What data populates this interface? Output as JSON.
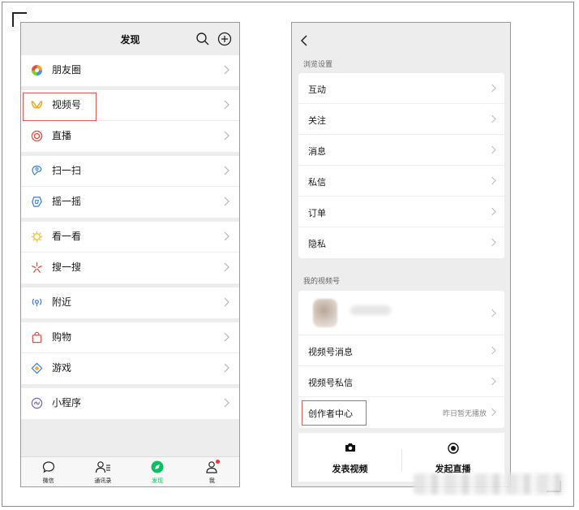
{
  "left_phone": {
    "header": {
      "title": "发现"
    },
    "sections": [
      [
        {
          "label": "朋友圈",
          "icon": "moments-icon"
        }
      ],
      [
        {
          "label": "视频号",
          "icon": "channels-icon"
        },
        {
          "label": "直播",
          "icon": "live-icon"
        }
      ],
      [
        {
          "label": "扫一扫",
          "icon": "scan-icon"
        },
        {
          "label": "摇一摇",
          "icon": "shake-icon"
        }
      ],
      [
        {
          "label": "看一看",
          "icon": "top-stories-icon"
        },
        {
          "label": "搜一搜",
          "icon": "search-star-icon"
        }
      ],
      [
        {
          "label": "附近",
          "icon": "nearby-icon"
        }
      ],
      [
        {
          "label": "购物",
          "icon": "shopping-icon"
        },
        {
          "label": "游戏",
          "icon": "games-icon"
        }
      ],
      [
        {
          "label": "小程序",
          "icon": "mini-programs-icon"
        }
      ]
    ],
    "tabbar": [
      {
        "label": "微信",
        "icon": "chat-icon"
      },
      {
        "label": "通讯录",
        "icon": "contacts-icon"
      },
      {
        "label": "发现",
        "icon": "discover-icon",
        "active": true
      },
      {
        "label": "我",
        "icon": "me-icon",
        "badge": true
      }
    ]
  },
  "right_phone": {
    "browse_settings": {
      "title": "浏览设置",
      "items": [
        "互动",
        "关注",
        "消息",
        "私信",
        "订单",
        "隐私"
      ]
    },
    "my_channel": {
      "title": "我的视频号",
      "items": [
        "视频号消息",
        "视频号私信",
        "创作者中心"
      ],
      "creator_status": "昨日暂无播放"
    },
    "actions": {
      "post_video": "发表视频",
      "start_live": "发起直播"
    }
  },
  "colors": {
    "accent_green": "#07c160",
    "highlight_red": "#e05a5a",
    "badge_red": "#f43530"
  }
}
